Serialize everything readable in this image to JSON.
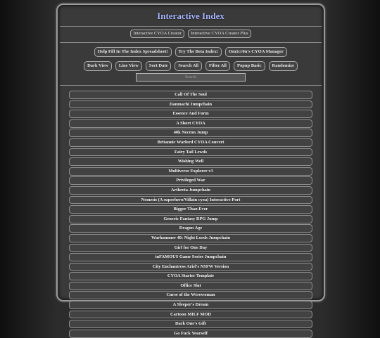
{
  "header": {
    "title": "Interactive Index"
  },
  "links": [
    "Interactive CYOA Creator",
    "Interactive CYOA Creator Plus"
  ],
  "actions": [
    "Help Fill In The Index Spreadsheet!",
    "Try The Beta Index!",
    "Om1cr0n's CYOA Manager"
  ],
  "toolbar": [
    "Dark View",
    "Line View",
    "Sort Date",
    "Search All",
    "Filter All",
    "Popup Basic",
    "Randomize"
  ],
  "search": {
    "placeholder": "Search"
  },
  "items": [
    "Call Of The Soul",
    "Danmachi Jumpchain",
    "Essence And Form",
    "A Short CYOA",
    "40k Necron Jump",
    "Britannic Warlord CYOA Convert",
    "Fairy Tail Lewds",
    "Wishing Well",
    "Multiverse Explorer v3",
    "Privileged War",
    "Arthreta Jumpchain",
    "Nemesis (A superhero/Villain cyoa) Interactive Port",
    "Bigger Than Ever",
    "Generic Fantasy RPG Jump",
    "Dragon Age",
    "Warhammer 40: Night Lords Jumpchain",
    "Girl for One Day",
    "inFAMOUS Game Series Jumpchain",
    "City Enchantress Ariel's NSFW Version",
    "CYOA Starter Template",
    "Office Slut",
    "Curse of the Werewoman",
    "A Sleeper's Dream",
    "Cartoon MILF MOD",
    "Dark One's Gift",
    "Go Fuck Yourself"
  ]
}
